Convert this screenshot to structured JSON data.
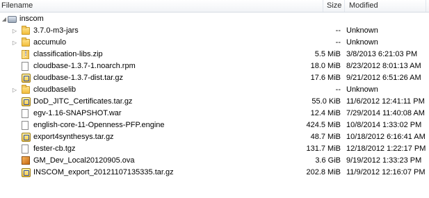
{
  "columns": {
    "filename": "Filename",
    "size": "Size",
    "modified": "Modified"
  },
  "root": {
    "name": "inscom",
    "icon": "drive-icon"
  },
  "rows": [
    {
      "name": "3.7.0-m3-jars",
      "size": "--",
      "modified": "Unknown",
      "icon": "folder-icon",
      "expandable": true
    },
    {
      "name": "accumulo",
      "size": "--",
      "modified": "Unknown",
      "icon": "folder-icon",
      "expandable": true
    },
    {
      "name": "classification-libs.zip",
      "size": "5.5 MiB",
      "modified": "3/8/2013 6:21:03 PM",
      "icon": "zip-icon",
      "expandable": false
    },
    {
      "name": "cloudbase-1.3.7-1.noarch.rpm",
      "size": "18.0 MiB",
      "modified": "8/23/2012 8:01:13 AM",
      "icon": "file-icon",
      "expandable": false
    },
    {
      "name": "cloudbase-1.3.7-dist.tar.gz",
      "size": "17.6 MiB",
      "modified": "9/21/2012 6:51:26 AM",
      "icon": "archive-icon",
      "expandable": false
    },
    {
      "name": "cloudbaselib",
      "size": "--",
      "modified": "Unknown",
      "icon": "folder-icon",
      "expandable": true
    },
    {
      "name": "DoD_JITC_Certificates.tar.gz",
      "size": "55.0 KiB",
      "modified": "11/6/2012 12:41:11 PM",
      "icon": "archive-icon",
      "expandable": false
    },
    {
      "name": "egv-1.16-SNAPSHOT.war",
      "size": "12.4 MiB",
      "modified": "7/29/2014 11:40:08 AM",
      "icon": "file-icon",
      "expandable": false
    },
    {
      "name": "english-core-11-Openness-PFP.engine",
      "size": "424.5 MiB",
      "modified": "10/8/2014 1:33:02 PM",
      "icon": "file-icon",
      "expandable": false
    },
    {
      "name": "export4synthesys.tar.gz",
      "size": "48.7 MiB",
      "modified": "10/18/2012 6:16:41 AM",
      "icon": "archive-icon",
      "expandable": false
    },
    {
      "name": "fester-cb.tgz",
      "size": "131.7 MiB",
      "modified": "12/18/2012 1:22:17 PM",
      "icon": "file-icon",
      "expandable": false
    },
    {
      "name": "GM_Dev_Local20120905.ova",
      "size": "3.6 GiB",
      "modified": "9/19/2012 1:33:23 PM",
      "icon": "package-icon",
      "expandable": false
    },
    {
      "name": "INSCOM_export_20121107135335.tar.gz",
      "size": "202.8 MiB",
      "modified": "11/9/2012 12:16:07 PM",
      "icon": "archive-icon",
      "expandable": false
    }
  ]
}
